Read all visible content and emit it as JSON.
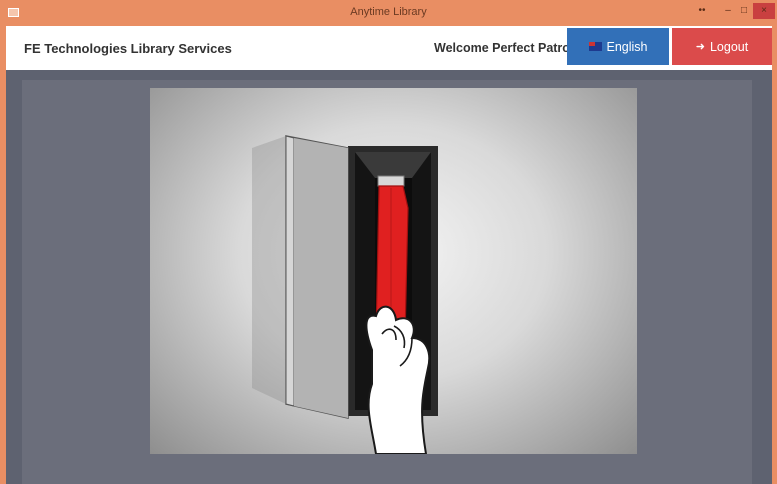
{
  "window": {
    "title": "Anytime Library",
    "controls": {
      "extra": "••",
      "minimize": "–",
      "maximize": "□",
      "close": "×"
    }
  },
  "header": {
    "brand": "FE Technologies Library Services",
    "welcome": "Welcome Perfect Patron",
    "language_button": "English",
    "logout_button": "Logout"
  },
  "colors": {
    "titlebar": "#e98e63",
    "language_button": "#3270b8",
    "logout_button": "#db4b4b",
    "book": "#e02020"
  },
  "illustration": {
    "subject": "book-return-slot-animation",
    "icons": [
      "return-slot-door-icon",
      "red-book-icon",
      "hand-icon"
    ]
  }
}
